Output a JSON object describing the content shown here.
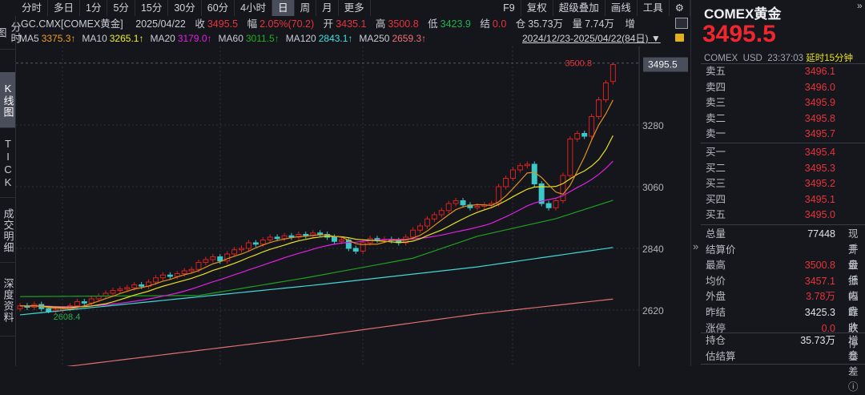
{
  "toolbar": {
    "tabs": [
      "分时",
      "多日",
      "1分",
      "5分",
      "15分",
      "30分",
      "60分",
      "4小时",
      "日",
      "周",
      "月",
      "更多"
    ],
    "active": "日",
    "right": [
      "F9",
      "复权",
      "超级叠加",
      "画线",
      "工具"
    ]
  },
  "sidenav": [
    "分时图",
    "K线图",
    "TICK",
    "成交明细",
    "深度资料"
  ],
  "info": {
    "symbol": "GC.CMX[COMEX黄金]",
    "date": "2025/04/22",
    "close_label": "收",
    "close": "3495.5",
    "chg_label": "幅",
    "chg": "2.05%(70.2)",
    "open_label": "开",
    "open": "3435.1",
    "high_label": "高",
    "high": "3500.8",
    "low_label": "低",
    "low": "3423.9",
    "settle_label": "结",
    "settle": "0.0",
    "oi_label": "仓",
    "oi": "35.73万",
    "vol_label": "量",
    "vol": "7.74万",
    "inc_label": "增"
  },
  "mas": [
    {
      "label": "MA5",
      "value": "3375.3↑",
      "color": "#f0a020"
    },
    {
      "label": "MA10",
      "value": "3265.1↑",
      "color": "#f0f020"
    },
    {
      "label": "MA20",
      "value": "3179.0↑",
      "color": "#e020e0"
    },
    {
      "label": "MA60",
      "value": "3011.5↑",
      "color": "#20b020"
    },
    {
      "label": "MA120",
      "value": "2843.1↑",
      "color": "#40e0e0"
    },
    {
      "label": "MA250",
      "value": "2659.3↑",
      "color": "#f07070"
    }
  ],
  "range": "2024/12/23-2025/04/22(84日)",
  "chart_data": {
    "type": "candlestick",
    "title": "GC.CMX 日K",
    "ylim": [
      2480,
      3560
    ],
    "yticks": [
      "3280",
      "3060",
      "2840",
      "2620"
    ],
    "ytick_values": [
      3280,
      3060,
      2840,
      2620
    ],
    "closes": [
      2635,
      2630,
      2640,
      2625,
      2615,
      2620,
      2625,
      2635,
      2650,
      2645,
      2660,
      2670,
      2680,
      2690,
      2695,
      2700,
      2710,
      2705,
      2720,
      2735,
      2745,
      2740,
      2750,
      2760,
      2765,
      2790,
      2800,
      2810,
      2795,
      2820,
      2835,
      2840,
      2860,
      2855,
      2870,
      2880,
      2875,
      2885,
      2880,
      2890,
      2885,
      2895,
      2890,
      2880,
      2865,
      2870,
      2840,
      2830,
      2860,
      2875,
      2870,
      2872,
      2868,
      2860,
      2880,
      2905,
      2920,
      2945,
      2960,
      2975,
      3000,
      3010,
      2995,
      2985,
      2990,
      2995,
      3000,
      3060,
      3090,
      3120,
      3135,
      3140,
      3070,
      3000,
      2985,
      3010,
      3100,
      3230,
      3250,
      3240,
      3310,
      3370,
      3430,
      3495.5
    ],
    "first_open": 2625,
    "last_bar": {
      "open": 3435.1,
      "high": 3500.8,
      "low": 3423.9,
      "close": 3495.5
    },
    "ma60": [
      [
        0,
        2668
      ],
      [
        25,
        2672
      ],
      [
        40,
        2735
      ],
      [
        55,
        2805
      ],
      [
        64,
        2883
      ],
      [
        75,
        2946
      ],
      [
        83,
        3011.5
      ]
    ],
    "ma120": [
      [
        0,
        2603
      ],
      [
        42,
        2711
      ],
      [
        64,
        2774
      ],
      [
        83,
        2843.1
      ]
    ],
    "ma250": [
      [
        0,
        2398
      ],
      [
        7,
        2420
      ],
      [
        42,
        2529
      ],
      [
        64,
        2606
      ],
      [
        83,
        2659.3
      ]
    ],
    "high_label": "3500.8",
    "low_label": "2608.4",
    "last_tag": "3495.5"
  },
  "quote": {
    "name": "COMEX黄金",
    "price": "3495.5",
    "exchange": "COMEX",
    "currency": "USD",
    "time": "23:37:03",
    "delay": "延时15分钟",
    "asks": [
      {
        "k": "卖五",
        "v": "3496.1"
      },
      {
        "k": "卖四",
        "v": "3496.0"
      },
      {
        "k": "卖三",
        "v": "3495.9"
      },
      {
        "k": "卖二",
        "v": "3495.8"
      },
      {
        "k": "卖一",
        "v": "3495.7"
      }
    ],
    "bids": [
      {
        "k": "买一",
        "v": "3495.4"
      },
      {
        "k": "买二",
        "v": "3495.3"
      },
      {
        "k": "买三",
        "v": "3495.2"
      },
      {
        "k": "买四",
        "v": "3495.1"
      },
      {
        "k": "买五",
        "v": "3495.0"
      }
    ],
    "stats": [
      {
        "k": "总量",
        "v": "77448",
        "c": "#e0e3ea",
        "k2": "现手"
      },
      {
        "k": "结算价",
        "v": "",
        "c": "#e0e3ea",
        "k2": "开盘"
      },
      {
        "k": "最高",
        "v": "3500.8",
        "c": "#e8333a",
        "k2": "最低"
      },
      {
        "k": "均价",
        "v": "3457.1",
        "c": "#e8333a",
        "k2": "振幅"
      },
      {
        "k": "外盘",
        "v": "3.78万",
        "c": "#e8333a",
        "k2": "内盘"
      },
      {
        "k": "昨结",
        "v": "3425.3",
        "c": "#e0e3ea",
        "k2": "昨收"
      },
      {
        "k": "涨停",
        "v": "0.0",
        "c": "#e8333a",
        "k2": "跌停"
      }
    ],
    "stats2": [
      {
        "k": "持仓",
        "v": "35.73万",
        "c": "#e0e3ea",
        "k2": "增仓"
      },
      {
        "k": "估结算",
        "v": "",
        "c": "#e0e3ea",
        "k2": "基差ⓘ"
      }
    ]
  }
}
